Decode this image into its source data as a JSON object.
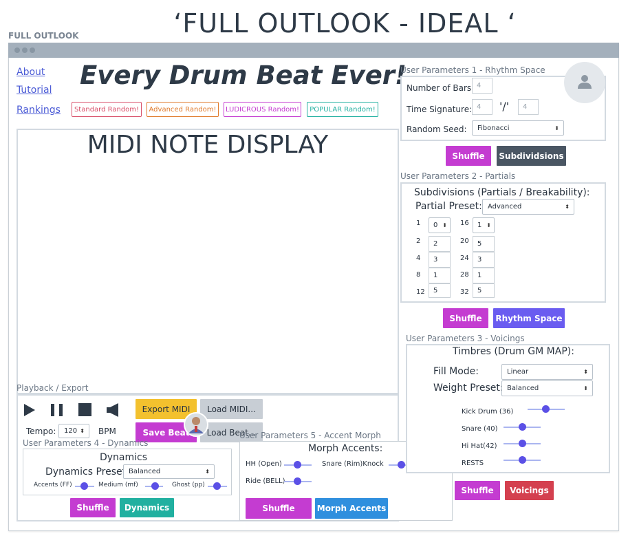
{
  "header": {
    "page_title": "‘FULL OUTLOOK - IDEAL ‘",
    "caption": "FULL OUTLOOK"
  },
  "nav": [
    "About",
    "Tutorial",
    "Rankings"
  ],
  "hero_title": "Every Drum Beat Ever!",
  "random_buttons": [
    {
      "label": "Standard Random!",
      "color": "#d9506a"
    },
    {
      "label": "Advanced Random!",
      "color": "#e07b2c"
    },
    {
      "label": "LUDICROUS Random!",
      "color": "#c43cd1"
    },
    {
      "label": "POPULAR Random!",
      "color": "#21b0a0"
    }
  ],
  "midi": {
    "title": "MIDI NOTE DISPLAY"
  },
  "playback": {
    "section_label": "Playback / Export",
    "export_midi": "Export MIDI",
    "load_midi": "Load MIDI...",
    "save_beat": "Save Beat",
    "load_beat": "Load Beat...",
    "tempo_label": "Tempo:",
    "tempo_value": "120",
    "bpm": "BPM",
    "icons": [
      "play-icon",
      "pause-icon",
      "stop-icon",
      "volume-icon"
    ]
  },
  "up1": {
    "title": "User Parameters 1 - Rhythm Space",
    "bars_label": "Number of Bars:",
    "bars_value": "4",
    "timesig_label": "Time Signature:",
    "timesig_num": "4",
    "timesig_sep": "'/'",
    "timesig_den": "4",
    "seed_label": "Random Seed:",
    "seed_value": "Fibonacci",
    "shuffle": "Shuffle",
    "action": "Subdividsions"
  },
  "up2": {
    "title": "User Parameters 2 - Partials",
    "heading": "Subdivisions (Partials / Breakability):",
    "preset_label": "Partial Preset:",
    "preset_value": "Advanced",
    "left_rows": [
      {
        "n": "1",
        "v": "0"
      },
      {
        "n": "2",
        "v": "2"
      },
      {
        "n": "4",
        "v": "3"
      },
      {
        "n": "8",
        "v": "1"
      },
      {
        "n": "12",
        "v": "5"
      }
    ],
    "right_rows": [
      {
        "n": "16",
        "v": "1"
      },
      {
        "n": "20",
        "v": "5"
      },
      {
        "n": "24",
        "v": "3"
      },
      {
        "n": "28",
        "v": "1"
      },
      {
        "n": "32",
        "v": "5"
      }
    ],
    "shuffle": "Shuffle",
    "action": "Rhythm Space"
  },
  "up3": {
    "title": "User Parameters 3 - Voicings",
    "heading": "Timbres (Drum GM MAP):",
    "fill_label": "Fill Mode:",
    "fill_value": "Linear",
    "weight_label": "Weight Preset:",
    "weight_value": "Balanced",
    "sliders": [
      {
        "label": "Kick Drum (36)",
        "value": 0.35
      },
      {
        "label": "Snare (40)",
        "value": 0.5
      },
      {
        "label": "Hi Hat(42)",
        "value": 0.5
      },
      {
        "label": "RESTS",
        "value": 0.5
      }
    ],
    "shuffle": "Shuffle",
    "action": "Voicings"
  },
  "up4": {
    "title": "User Parameters 4 - Dynamics",
    "heading": "Dynamics",
    "preset_label": "Dynamics Preset:",
    "preset_value": "Balanced",
    "sliders": [
      {
        "label": "Accents (FF)",
        "value": 0.5
      },
      {
        "label": "Medium (mf)",
        "value": 0.5
      },
      {
        "label": "Ghost (pp)",
        "value": 0.5
      }
    ],
    "shuffle": "Shuffle",
    "action": "Dynamics"
  },
  "up5": {
    "title": "User Parameters 5 - Accent Morph",
    "heading": "Morph Accents:",
    "sliders": [
      {
        "label": "HH (Open)",
        "value": 0.5
      },
      {
        "label": "Snare (Rim)Knock",
        "value": 0.5
      },
      {
        "label": "Ride (BELL)",
        "value": 0.5
      }
    ],
    "shuffle": "Shuffle",
    "action": "Morph Accents"
  }
}
